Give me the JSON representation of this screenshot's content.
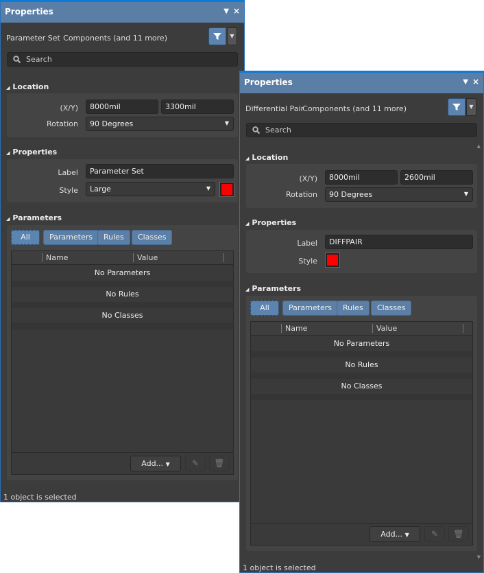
{
  "panels": [
    {
      "title": "Properties",
      "object_type": "Parameter Set",
      "filter_label": "Components (and 11 more)",
      "search_placeholder": "Search",
      "location": {
        "header": "Location",
        "xy_label": "(X/Y)",
        "x": "8000mil",
        "y": "3300mil",
        "rotation_label": "Rotation",
        "rotation": "90 Degrees"
      },
      "properties": {
        "header": "Properties",
        "label_label": "Label",
        "label": "Parameter Set",
        "style_label": "Style",
        "style": "Large"
      },
      "parameters": {
        "header": "Parameters",
        "chips": [
          "All",
          "Parameters",
          "Rules",
          "Classes"
        ],
        "columns": [
          "Name",
          "Value"
        ],
        "rows": [
          "No Parameters",
          "No Rules",
          "No Classes"
        ],
        "add": "Add..."
      },
      "status": "1 object is selected"
    },
    {
      "title": "Properties",
      "object_type": "Differential Pair",
      "filter_label": "Components (and 11 more)",
      "search_placeholder": "Search",
      "location": {
        "header": "Location",
        "xy_label": "(X/Y)",
        "x": "8000mil",
        "y": "2600mil",
        "rotation_label": "Rotation",
        "rotation": "90 Degrees"
      },
      "properties": {
        "header": "Properties",
        "label_label": "Label",
        "label": "DIFFPAIR",
        "style_label": "Style"
      },
      "parameters": {
        "header": "Parameters",
        "chips": [
          "All",
          "Parameters",
          "Rules",
          "Classes"
        ],
        "columns": [
          "Name",
          "Value"
        ],
        "rows": [
          "No Parameters",
          "No Rules",
          "No Classes"
        ],
        "add": "Add..."
      },
      "status": "1 object is selected"
    }
  ],
  "colors": {
    "accent": "#5b7fa6",
    "swatch": "#ff0000"
  }
}
